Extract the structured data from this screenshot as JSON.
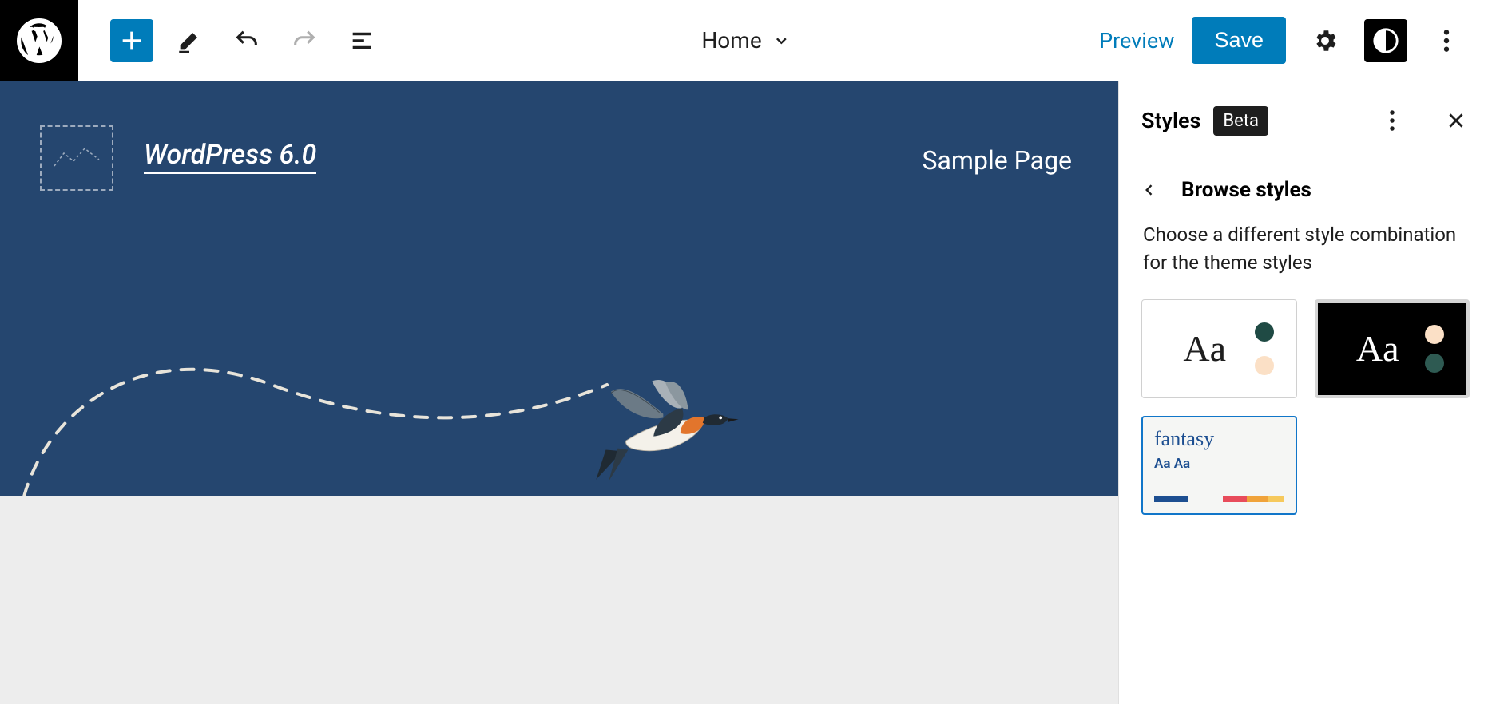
{
  "toolbar": {
    "document_title": "Home",
    "preview_label": "Preview",
    "save_label": "Save"
  },
  "canvas": {
    "site_title": "WordPress 6.0",
    "nav_item": "Sample Page"
  },
  "sidebar": {
    "title": "Styles",
    "badge": "Beta",
    "panel_title": "Browse styles",
    "description": "Choose a different style combination for the theme styles",
    "variations": {
      "default_aa": "Aa",
      "dark_aa": "Aa",
      "fantasy_label": "fantasy",
      "fantasy_aa": "Aa  Aa"
    },
    "colors": {
      "default_dot1": "#1f4a44",
      "default_dot2": "#fbe0c6",
      "dark_dot1": "#fbe0c6",
      "dark_dot2": "#2e5a52"
    }
  }
}
